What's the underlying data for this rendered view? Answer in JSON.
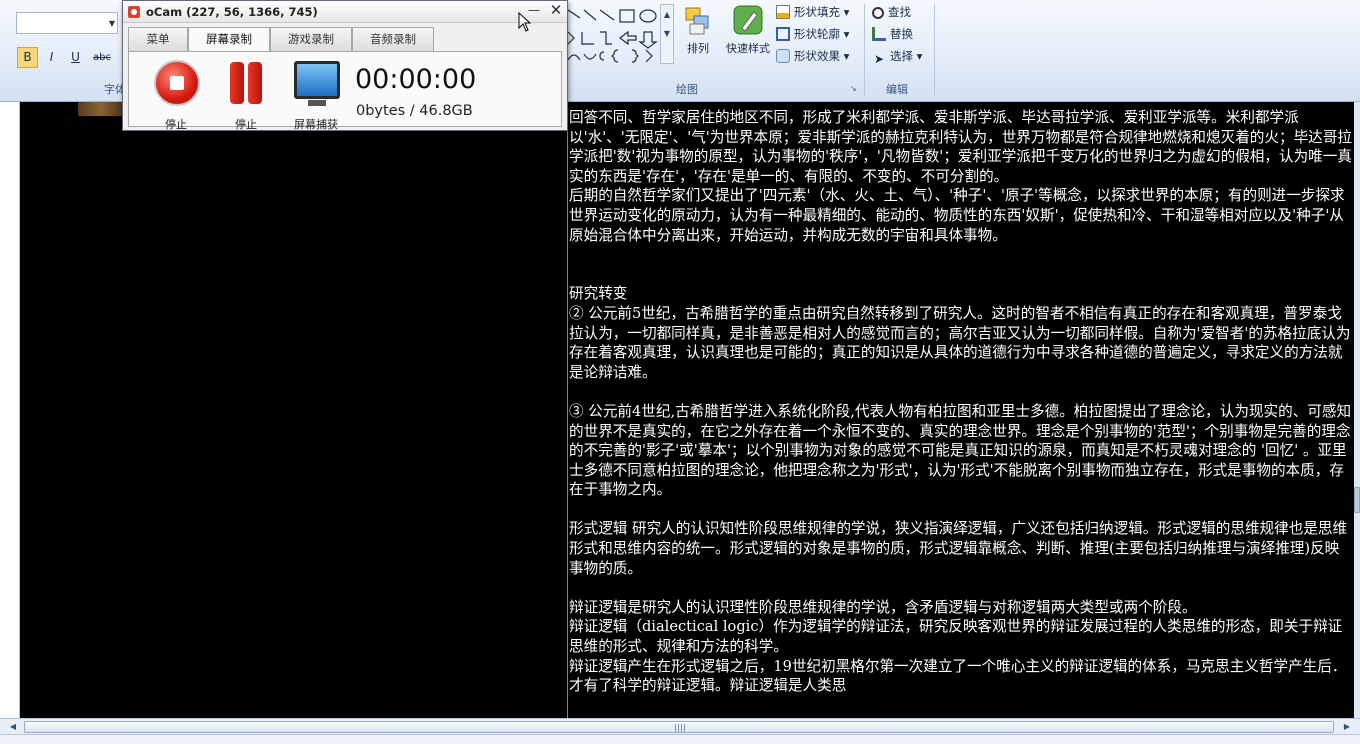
{
  "ribbon": {
    "group_font": "字体",
    "group_draw": "绘图",
    "group_edit": "编辑",
    "bold": "B",
    "italic": "I",
    "underline": "U",
    "strike": "abc",
    "arrange": "排列",
    "quick_styles": "快速样式",
    "shape_fill": "形状填充",
    "shape_outline": "形状轮廓",
    "shape_effects": "形状效果",
    "find": "查找",
    "replace": "替换",
    "select": "选择"
  },
  "ocam": {
    "title": "oCam (227, 56, 1366, 745)",
    "tabs": [
      {
        "label": "菜单"
      },
      {
        "label": "屏幕录制"
      },
      {
        "label": "游戏录制"
      },
      {
        "label": "音频录制"
      }
    ],
    "stop_label": "停止",
    "pause_label": "停止",
    "capture_label": "屏幕捕获",
    "timer": "00:00:00",
    "size": "0bytes / 46.8GB"
  },
  "document": {
    "paragraphs": [
      "回答不同、哲学家居住的地区不同，形成了米利都学派、爱非斯学派、毕达哥拉学派、爱利亚学派等。米利都学派以'水'、'无限定'、'气'为世界本原；爱非斯学派的赫拉克利特认为，世界万物都是符合规律地燃烧和熄灭着的火；毕达哥拉学派把'数'视为事物的原型，认为事物的'秩序'，'凡物皆数'；爱利亚学派把千变万化的世界归之为虚幻的假相，认为唯一真实的东西是'存在'，'存在'是单一的、有限的、不变的、不可分割的。",
      "后期的自然哲学家们又提出了'四元素'（水、火、土、气）、'种子'、'原子'等概念，以探求世界的本原；有的则进一步探求世界运动变化的原动力，认为有一种最精细的、能动的、物质性的东西'奴斯'，促使热和冷、干和湿等相对应以及'种子'从原始混合体中分离出来，开始运动，并构成无数的宇宙和具体事物。",
      "",
      "",
      "研究转变",
      "② 公元前5世纪，古希腊哲学的重点由研究自然转移到了研究人。这时的智者不相信有真正的存在和客观真理，普罗泰戈拉认为，一切都同样真，是非善恶是相对人的感觉而言的；高尔吉亚又认为一切都同样假。自称为'爱智者'的苏格拉底认为存在着客观真理，认识真理也是可能的；真正的知识是从具体的道德行为中寻求各种道德的普遍定义，寻求定义的方法就是论辩诘难。",
      "",
      "③ 公元前4世纪,古希腊哲学进入系统化阶段,代表人物有柏拉图和亚里士多德。柏拉图提出了理念论，认为现实的、可感知的世界不是真实的，在它之外存在着一个永恒不变的、真实的理念世界。理念是个别事物的'范型'；个别事物是完善的理念的不完善的'影子'或'摹本'；以个别事物为对象的感觉不可能是真正知识的源泉，而真知是不朽灵魂对理念的 '回忆' 。亚里士多德不同意柏拉图的理念论，他把理念称之为'形式'，认为'形式'不能脱离个别事物而独立存在，形式是事物的本质，存在于事物之内。",
      "",
      "形式逻辑 研究人的认识知性阶段思维规律的学说，狭义指演绎逻辑，广义还包括归纳逻辑。形式逻辑的思维规律也是思维形式和思维内容的统一。形式逻辑的对象是事物的质，形式逻辑靠概念、判断、推理(主要包括归纳推理与演绎推理)反映事物的质。",
      "",
      "辩证逻辑是研究人的认识理性阶段思维规律的学说，含矛盾逻辑与对称逻辑两大类型或两个阶段。",
      "辩证逻辑（dialectical logic）作为逻辑学的辩证法，研究反映客观世界的辩证发展过程的人类思维的形态，即关于辩证思维的形式、规律和方法的科学。",
      "辩证逻辑产生在形式逻辑之后，19世纪初黑格尔第一次建立了一个唯心主义的辩证逻辑的体系，马克思主义哲学产生后．才有了科学的辩证逻辑。辩证逻辑是人类思"
    ]
  }
}
